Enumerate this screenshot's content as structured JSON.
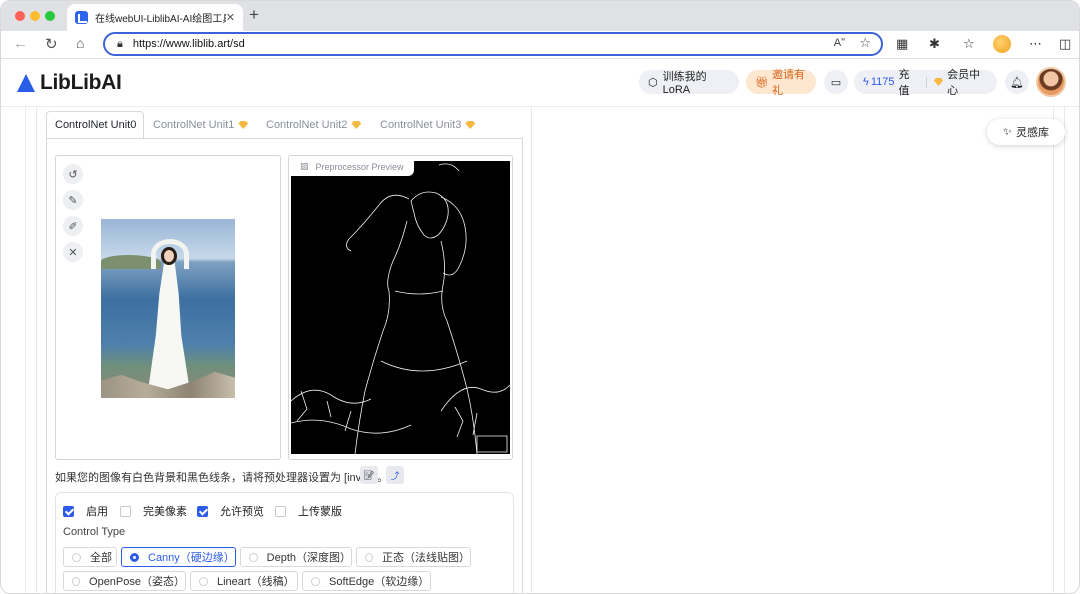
{
  "browser": {
    "tab_title": "在线webUI-LiblibAI-AI绘图工具",
    "tab_close": "✕",
    "new_tab": "+",
    "url": "https://www.liblib.art/sd",
    "read_aloud": "Aʺ",
    "colors": {
      "address_border": "#3c63d6",
      "tab_bar": "#dfe1e5"
    }
  },
  "header": {
    "logo_text": "LibLibAI",
    "train_lora": "训练我的LoRA",
    "invite": "邀请有礼",
    "credits": "1175",
    "recharge": "充值",
    "vip_center": "会员中心",
    "colors": {
      "brand": "#2a5ee8",
      "invite": "#d9631b"
    }
  },
  "inspiration": {
    "label": "灵感库"
  },
  "controlnet": {
    "tabs": [
      {
        "label": "ControlNet Unit0",
        "active": true
      },
      {
        "label": "ControlNet Unit1",
        "active": false
      },
      {
        "label": "ControlNet Unit2",
        "active": false
      },
      {
        "label": "ControlNet Unit3",
        "active": false
      }
    ],
    "preview_label": "Preprocessor Preview",
    "hint": "如果您的图像有白色背景和黑色线条，请将预处理器设置为 [invert]。",
    "checkboxes": [
      {
        "label": "启用",
        "checked": true
      },
      {
        "label": "完美像素",
        "checked": false
      },
      {
        "label": "允许预览",
        "checked": true
      },
      {
        "label": "上传蒙版",
        "checked": false
      }
    ],
    "control_type_label": "Control Type",
    "control_types": [
      {
        "label": "全部",
        "selected": false
      },
      {
        "label": "Canny（硬边缘）",
        "selected": true
      },
      {
        "label": "Depth（深度图）",
        "selected": false
      },
      {
        "label": "正态（法线贴图）",
        "selected": false
      },
      {
        "label": "OpenPose（姿态）",
        "selected": false
      },
      {
        "label": "Lineart（线稿）",
        "selected": false
      },
      {
        "label": "SoftEdge（软边缘）",
        "selected": false
      }
    ],
    "accent": "#2d5ce8"
  }
}
